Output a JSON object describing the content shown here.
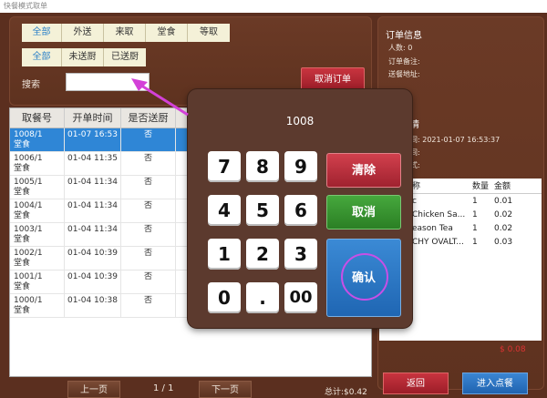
{
  "window": {
    "title": "快餐模式取单"
  },
  "filters": {
    "type_tabs": [
      "全部",
      "外送",
      "来取",
      "堂食",
      "等取"
    ],
    "type_active": 0,
    "status_tabs": [
      "全部",
      "未送厨",
      "已送厨"
    ],
    "status_active": 0
  },
  "search": {
    "label": "搜索",
    "value": ""
  },
  "buttons": {
    "cancel_order": "取消订单",
    "prev_page": "上一页",
    "next_page": "下一页",
    "back": "返回",
    "enter_order": "进入点餐"
  },
  "orders": {
    "columns": [
      "取餐号",
      "开单时间",
      "是否送厨"
    ],
    "rows": [
      {
        "no": "1008/1",
        "type": "堂食",
        "time": "01-07 16:53",
        "sent": "否",
        "selected": true
      },
      {
        "no": "1006/1",
        "type": "堂食",
        "time": "01-04 11:35",
        "sent": "否"
      },
      {
        "no": "1005/1",
        "type": "堂食",
        "time": "01-04 11:34",
        "sent": "否"
      },
      {
        "no": "1004/1",
        "type": "堂食",
        "time": "01-04 11:34",
        "sent": "否"
      },
      {
        "no": "1003/1",
        "type": "堂食",
        "time": "01-04 11:34",
        "sent": "否"
      },
      {
        "no": "1002/1",
        "type": "堂食",
        "time": "01-04 10:39",
        "sent": "否"
      },
      {
        "no": "1001/1",
        "type": "堂食",
        "time": "01-04 10:39",
        "sent": "否"
      },
      {
        "no": "1000/1",
        "type": "堂食",
        "time": "01-04 10:38",
        "sent": "否"
      }
    ],
    "page": "1 / 1",
    "total": "总计:$0.42"
  },
  "order_info": {
    "title": "订单信息",
    "people": "人数: 0",
    "note": "订单备注:",
    "address": "送餐地址:"
  },
  "order_detail": {
    "title_partial": "情",
    "time_partial": "间: 2021-01-07 16:53:37",
    "line2_partial": "间:",
    "line3_partial": "式:",
    "columns": [
      "称",
      "数量",
      "金额"
    ],
    "items": [
      {
        "name": "c",
        "qty": "1",
        "amount": "0.01"
      },
      {
        "name": " Chicken Sa...",
        "qty": "1",
        "amount": "0.02"
      },
      {
        "name": "eason Tea",
        "qty": "1",
        "amount": "0.02"
      },
      {
        "name": "CHY OVALT...",
        "qty": "1",
        "amount": "0.03"
      }
    ],
    "total": "$ 0.08"
  },
  "keypad": {
    "display": "1008",
    "keys": [
      "7",
      "8",
      "9",
      "4",
      "5",
      "6",
      "1",
      "2",
      "3",
      "0",
      ".",
      "00"
    ],
    "clear": "清除",
    "cancel": "取消",
    "confirm": "确认"
  },
  "colors": {
    "wood": "#5b2f1f",
    "selected_row": "#2f86d6",
    "red_button": "#b02a36",
    "green_button": "#3a9632",
    "blue_button": "#2d78c4",
    "annotation": "#c84fe6"
  }
}
